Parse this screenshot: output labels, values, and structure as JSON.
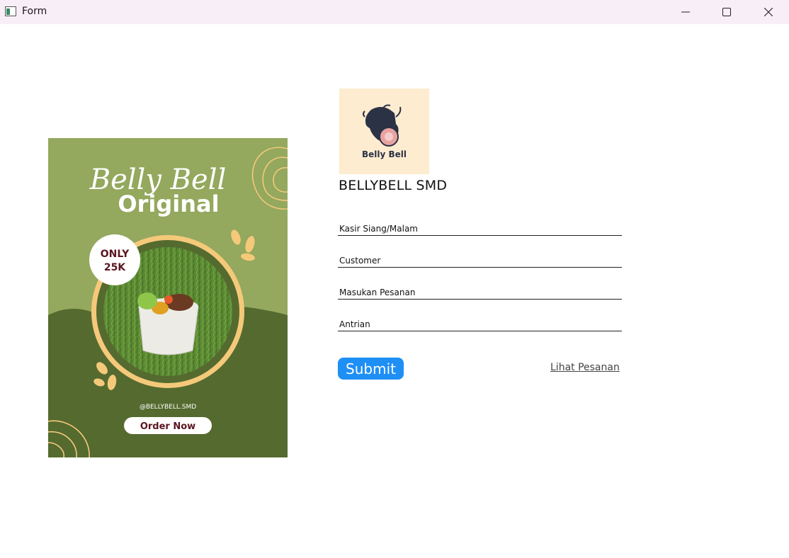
{
  "window": {
    "title": "Form"
  },
  "poster": {
    "headline_script": "Belly Bell",
    "headline": "Original",
    "badge_line1": "ONLY",
    "badge_line2": "25K",
    "handle": "@BELLYBELL.SMD",
    "cta": "Order Now",
    "colors": {
      "light_green": "#94a85e",
      "dark_green": "#556a2f",
      "accent": "#f5c97a",
      "maroon": "#5a1620"
    }
  },
  "logo": {
    "text": "Belly Bell"
  },
  "brand": {
    "title": "BELLYBELL SMD"
  },
  "form": {
    "kasir_placeholder": "Kasir Siang/Malam",
    "customer_placeholder": "Customer",
    "pesanan_placeholder": "Masukan Pesanan",
    "antrian_placeholder": "Antrian",
    "submit_label": "Submit",
    "view_orders_label": "Lihat Pesanan"
  },
  "colors": {
    "submit": "#1e8ff5",
    "titlebar": "#f8eef8"
  }
}
